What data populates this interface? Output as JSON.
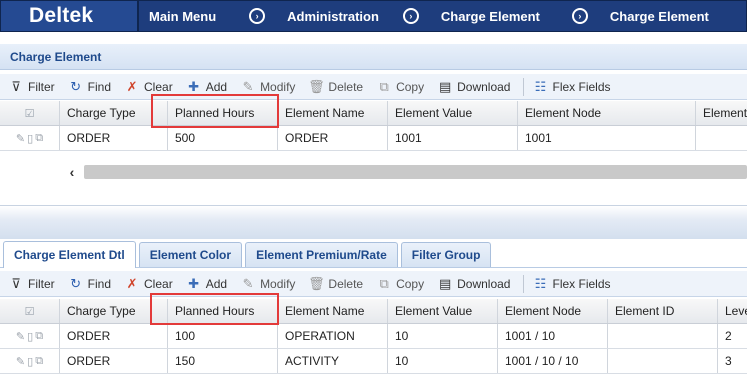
{
  "header": {
    "logo": "Deltek",
    "breadcrumbs": [
      "Main Menu",
      "Administration",
      "Charge Element",
      "Charge Element"
    ]
  },
  "top_panel": {
    "title": "Charge Element",
    "toolbar": [
      "Filter",
      "Find",
      "Clear",
      "Add",
      "Modify",
      "Delete",
      "Copy",
      "Download",
      "Flex Fields"
    ],
    "columns": [
      "Charge Type",
      "Planned Hours",
      "Element Name",
      "Element Value",
      "Element Node",
      "Element"
    ],
    "rows": [
      [
        "ORDER",
        "500",
        "ORDER",
        "1001",
        "1001",
        ""
      ]
    ]
  },
  "tabs": [
    "Charge Element Dtl",
    "Element Color",
    "Element Premium/Rate",
    "Filter Group"
  ],
  "bottom_panel": {
    "toolbar": [
      "Filter",
      "Find",
      "Clear",
      "Add",
      "Modify",
      "Delete",
      "Copy",
      "Download",
      "Flex Fields"
    ],
    "columns": [
      "Charge Type",
      "Planned Hours",
      "Element Name",
      "Element Value",
      "Element Node",
      "Element ID",
      "Leve"
    ],
    "rows": [
      [
        "ORDER",
        "100",
        "OPERATION",
        "10",
        "1001 / 10",
        "",
        "2"
      ],
      [
        "ORDER",
        "150",
        "ACTIVITY",
        "10",
        "1001 / 10 / 10",
        "",
        "3"
      ]
    ]
  }
}
